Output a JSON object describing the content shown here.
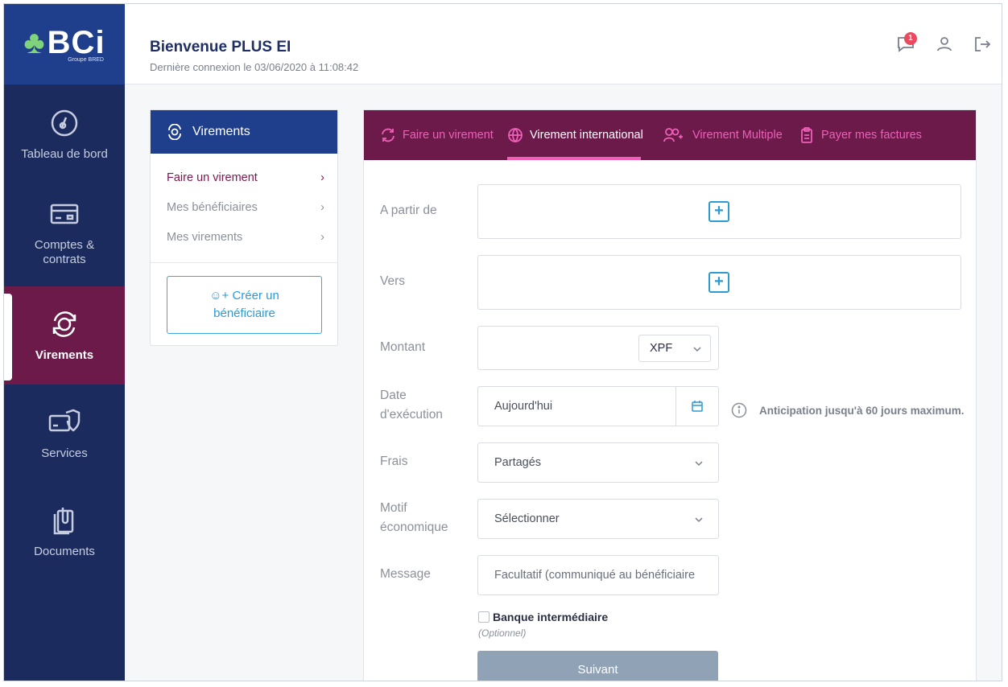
{
  "brand": {
    "logo_text": "BCi",
    "logo_sub": "Groupe BRED"
  },
  "sidebar": {
    "items": [
      {
        "label": "Tableau de bord",
        "icon": "dashboard-gauge-icon"
      },
      {
        "label": "Comptes & contrats",
        "icon": "card-icon"
      },
      {
        "label": "Virements",
        "icon": "transfer-cycle-icon",
        "active": true
      },
      {
        "label": "Services",
        "icon": "shield-card-icon"
      },
      {
        "label": "Documents",
        "icon": "documents-icon"
      }
    ]
  },
  "header": {
    "welcome": "Bienvenue PLUS EI",
    "last_login": "Dernière connexion le 03/06/2020 à 11:08:42",
    "notifications_count": "1"
  },
  "menu": {
    "title": "Virements",
    "links": [
      {
        "label": "Faire un virement",
        "active": true
      },
      {
        "label": "Mes bénéficiaires"
      },
      {
        "label": "Mes virements"
      }
    ],
    "create_button_line1": "Créer un",
    "create_button_line2": "bénéficiaire"
  },
  "tabs": [
    {
      "label": "Faire un virement"
    },
    {
      "label": "Virement international",
      "active": true
    },
    {
      "label": "Virement Multiple"
    },
    {
      "label": "Payer mes factures"
    }
  ],
  "form": {
    "from_label": "A partir de",
    "to_label": "Vers",
    "amount_label": "Montant",
    "currency": "XPF",
    "date_label_line1": "Date",
    "date_label_line2": "d'exécution",
    "date_value": "Aujourd'hui",
    "date_note": "Anticipation jusqu'à 60 jours maximum.",
    "fees_label": "Frais",
    "fees_value": "Partagés",
    "motive_label_line1": "Motif",
    "motive_label_line2": "économique",
    "motive_value": "Sélectionner",
    "message_label": "Message",
    "message_placeholder": "Facultatif (communiqué au bénéficiaire",
    "intermediary_label": "Banque intermédiaire",
    "intermediary_optional": "(Optionnel)",
    "next_button": "Suivant"
  },
  "colors": {
    "sidebar_bg": "#1b2b5d",
    "brand_blue": "#1f3f8c",
    "active_plum": "#6b1a4a",
    "accent_pink": "#ef5fb8",
    "accent_blue": "#2e9ad2",
    "button_disabled": "#8fa2b6"
  }
}
